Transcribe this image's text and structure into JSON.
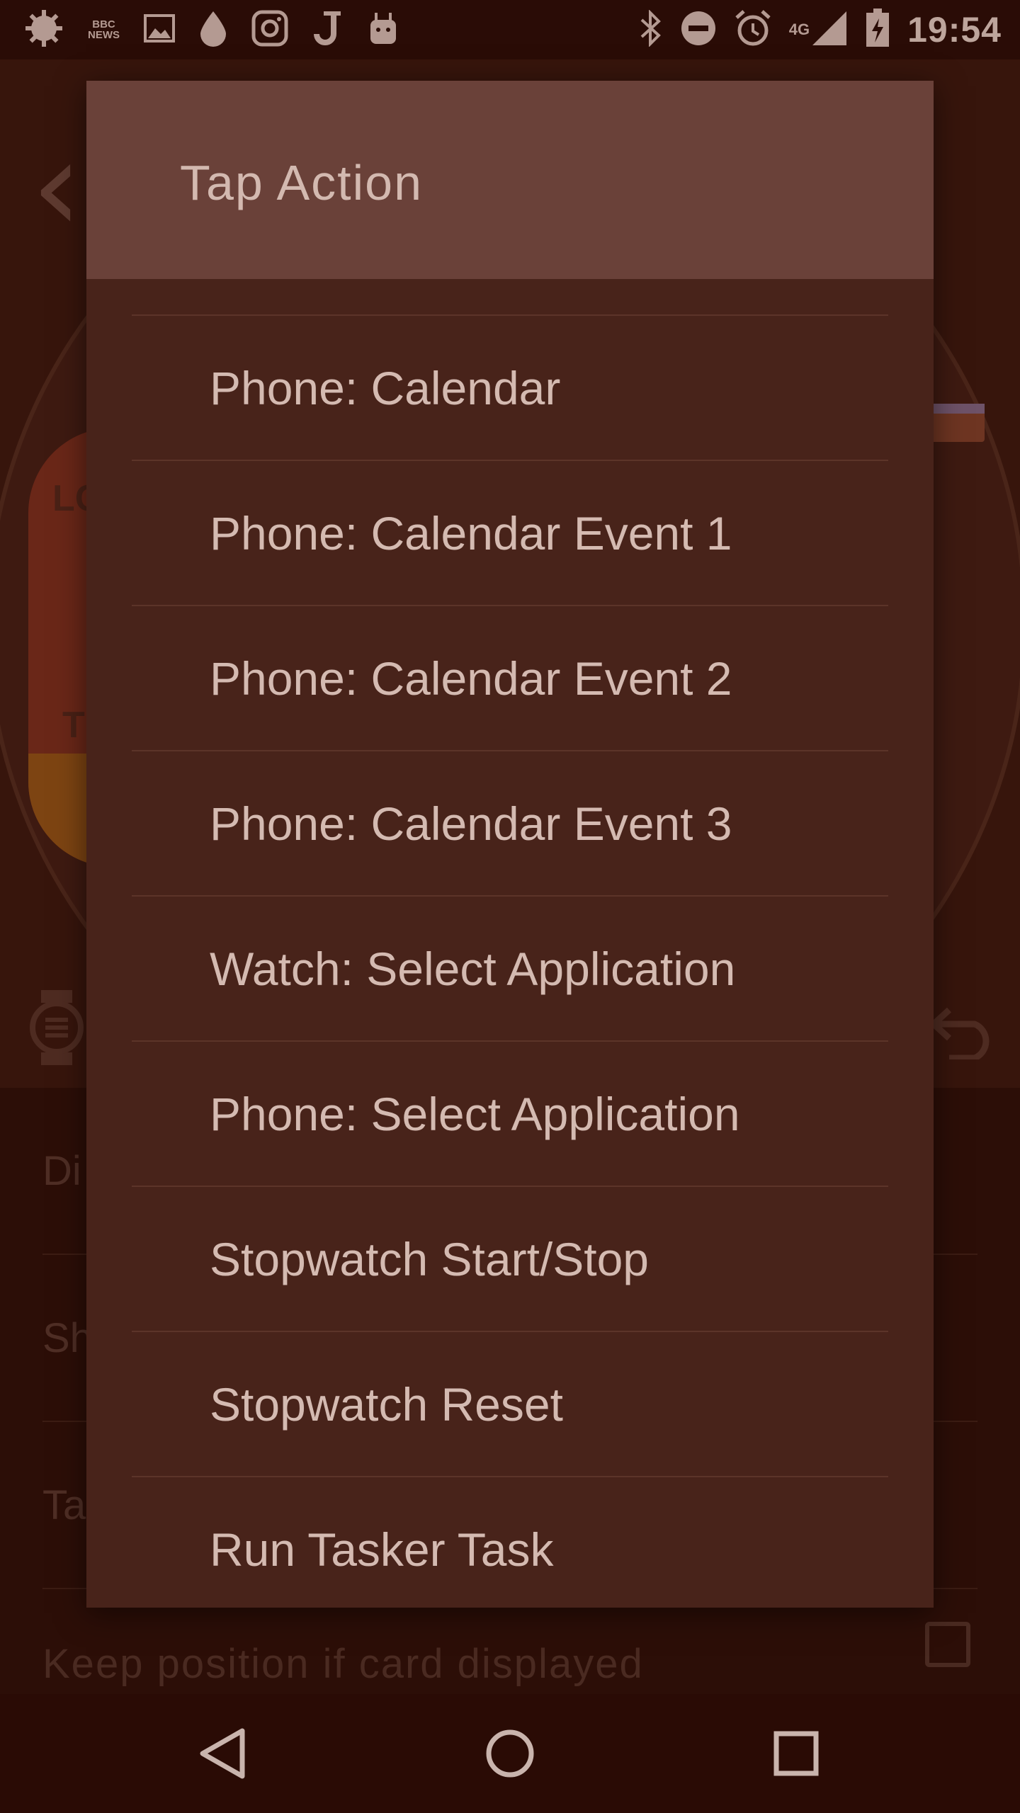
{
  "status_bar": {
    "time": "19:54",
    "network": "4G",
    "news_label_top": "BBC",
    "news_label_bottom": "NEWS",
    "left_icons": [
      "settings-gear-icon",
      "bbc-news-icon",
      "image-icon",
      "drop-icon",
      "instagram-icon",
      "j-app-icon",
      "android-icon"
    ],
    "right_icons": [
      "bluetooth-icon",
      "do-not-disturb-icon",
      "alarm-icon",
      "signal-icon",
      "battery-charging-icon"
    ]
  },
  "background": {
    "settings_rows": [
      "Di",
      "Sh",
      "Ta"
    ],
    "keep_position_label": "Keep position if card displayed",
    "dial_text_top": "LC",
    "dial_text_bottom": "T"
  },
  "dialog": {
    "title": "Tap Action",
    "options": [
      "Phone: Calendar",
      "Phone: Calendar Event 1",
      "Phone: Calendar Event 2",
      "Phone: Calendar Event 3",
      "Watch: Select Application",
      "Phone: Select Application",
      "Stopwatch Start/Stop",
      "Stopwatch Reset",
      "Run Tasker Task"
    ]
  },
  "nav_bar": {
    "buttons": [
      "back-icon",
      "home-icon",
      "recents-icon"
    ]
  },
  "colors": {
    "status_bar_bg": "#2a0c06",
    "dialog_header_bg": "#6a4139",
    "dialog_body_bg": "#48231a",
    "text_light": "#d4bab1"
  }
}
